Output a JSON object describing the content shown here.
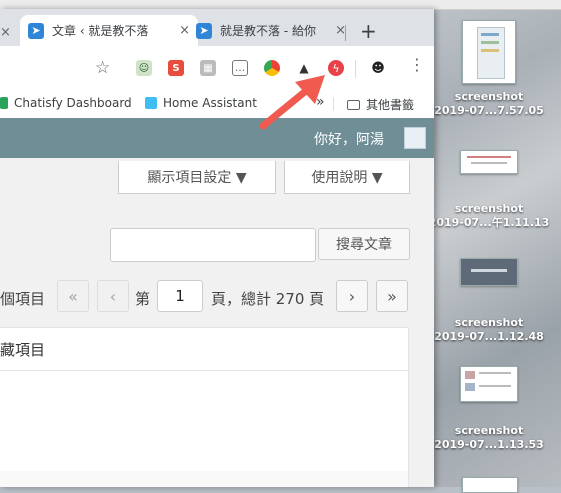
{
  "browser": {
    "tabs": [
      {
        "title": "文章 ‹ 就是教不落",
        "close": "×",
        "active": true
      },
      {
        "title": "就是教不落 - 給你",
        "close": "×",
        "active": false
      }
    ],
    "new_tab": "+",
    "toolbar": {
      "bookmark_star": "☆",
      "extensions": [
        "s-extension-icon",
        "photo-extension-icon",
        "chat-extension-icon",
        "chrome-extension-icon",
        "hat-extension-icon",
        "lightning-extension-icon",
        "avatar-extension-icon"
      ],
      "menu": "⋮"
    },
    "bookmarks": {
      "items": [
        {
          "label": "Chatisfy Dashboard"
        },
        {
          "label": "Home Assistant"
        }
      ],
      "overflow": "»",
      "other_folder": "其他書籤"
    }
  },
  "wp": {
    "greeting": "你好，阿湯",
    "screen_options": "顯示項目設定 ▼",
    "help": "使用說明 ▼",
    "search_button": "搜尋文章",
    "search_placeholder": "",
    "items_label": "個項目",
    "pagination": {
      "first": "«",
      "prev": "‹",
      "page_prefix": "第",
      "current_page": "1",
      "page_suffix": "頁，總計 270 頁",
      "next": "›",
      "last": "»"
    },
    "table_header": "藏項目"
  },
  "desktop": {
    "files": [
      {
        "name": "screenshot",
        "date": "2019-07...7.57.05"
      },
      {
        "name": "screenshot",
        "date": "2019-07...午1.11.13"
      },
      {
        "name": "screenshot",
        "date": "2019-07...1.12.48"
      },
      {
        "name": "screenshot",
        "date": "2019-07...1.13.53"
      }
    ]
  },
  "colors": {
    "wp_admin_bar": "#6f8e96",
    "arrow": "#f05a4f",
    "tab_favicon": "#2f86d6"
  }
}
